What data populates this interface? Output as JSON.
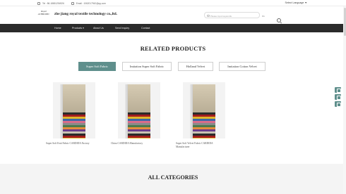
{
  "topbar": {
    "phone": "Tel : 86-18651254926",
    "email": "Email : 1062017942@qq.com",
    "language": "Select Language ▼"
  },
  "header": {
    "logo_line1": "Royal",
    "logo_line2": "ACHROMIC",
    "company_name": "zhe jiang royal textile technology co.,ltd."
  },
  "search": {
    "placeholder": "Please input keywords",
    "select_value": "Ov"
  },
  "nav": {
    "items": [
      {
        "label": "Home"
      },
      {
        "label": "Products ▾"
      },
      {
        "label": "About Us"
      },
      {
        "label": "Send Inquiry"
      },
      {
        "label": "Contact"
      }
    ]
  },
  "related": {
    "title": "RELATED PRODUCTS",
    "tabs": [
      {
        "label": "Super Soft Fabric",
        "active": true
      },
      {
        "label": "Imitation Super Soft Fabric",
        "active": false
      },
      {
        "label": "Holland Velvet",
        "active": false
      },
      {
        "label": "Imitation Cotton Velvet",
        "active": false
      }
    ],
    "products": [
      {
        "caption": "Super Soft Knit Fabric CARDIDA Factory"
      },
      {
        "caption": "China CARDIDA Manufactory"
      },
      {
        "caption": "Super Soft Velvet Fabric CARDIDA Manufacturer"
      }
    ]
  },
  "categories": {
    "title": "ALL CATEGORIES"
  },
  "colors": {
    "accent": "#5f8f8c",
    "nav_bg": "#2b2b2b"
  },
  "icons": [
    "phone-icon",
    "email-icon",
    "search-icon",
    "chat-icon",
    "mail-icon",
    "up-icon"
  ]
}
